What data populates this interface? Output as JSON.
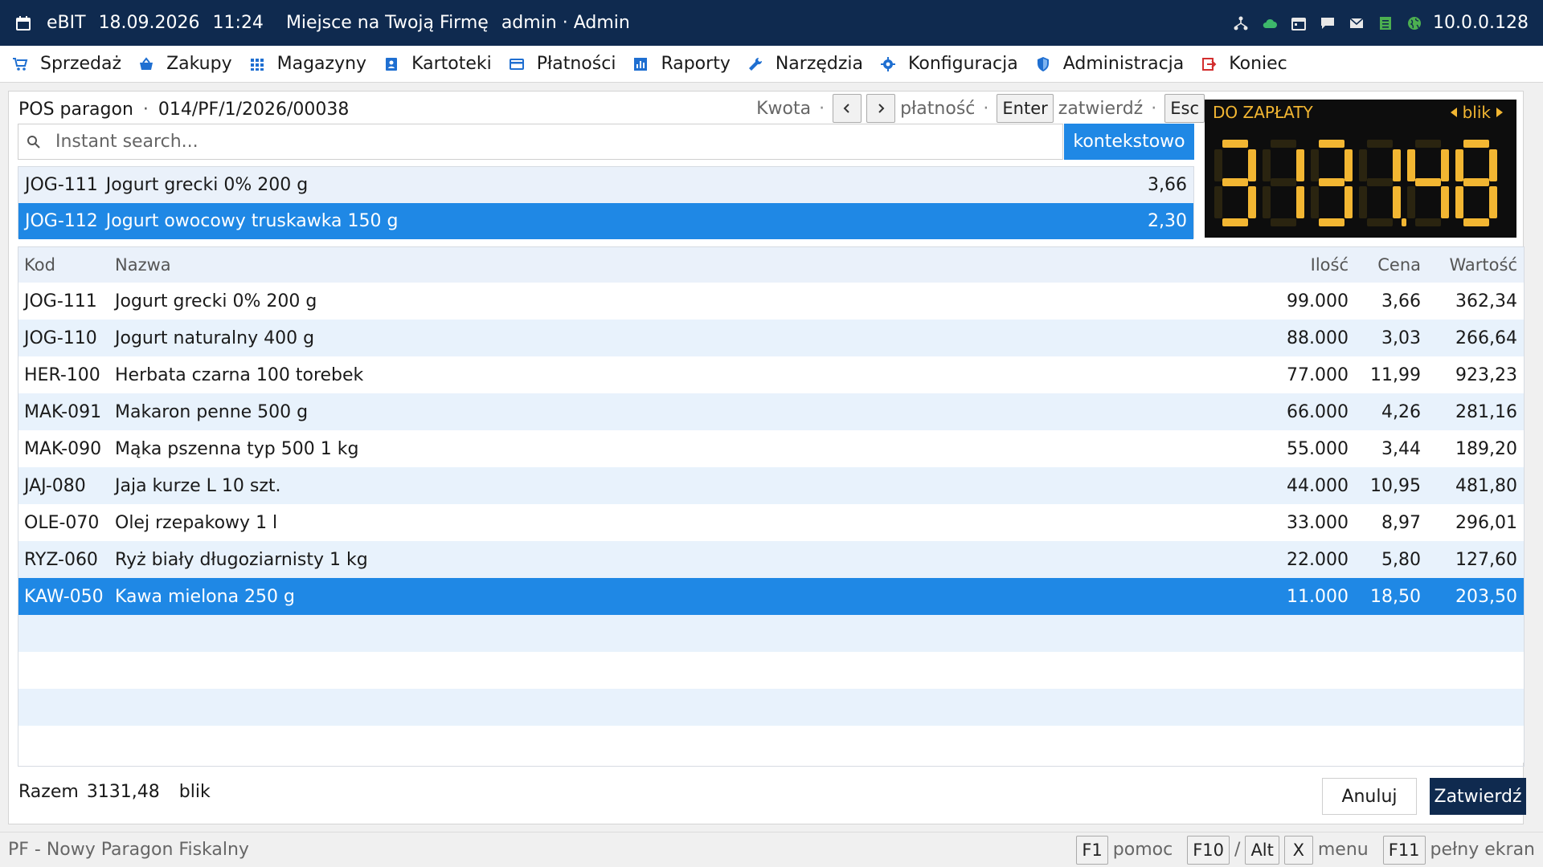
{
  "titlebar": {
    "app": "eBIT",
    "date": "18.09.2026",
    "time": "11:24",
    "company": "Miejsce na Twoją Firmę",
    "user": "admin · Admin",
    "ip": "10.0.0.128",
    "icons": [
      "calendar-icon",
      "network-icon",
      "cloud-icon",
      "calendar-icon",
      "chat-icon",
      "mail-icon",
      "list-icon",
      "globe-icon"
    ]
  },
  "menu": {
    "items": [
      {
        "label": "Sprzedaż",
        "icon": "cart-icon",
        "color": "#1f6fd1"
      },
      {
        "label": "Zakupy",
        "icon": "basket-icon",
        "color": "#1f6fd1"
      },
      {
        "label": "Magazyny",
        "icon": "grid-icon",
        "color": "#1f6fd1"
      },
      {
        "label": "Kartoteki",
        "icon": "contact-card-icon",
        "color": "#1f6fd1"
      },
      {
        "label": "Płatności",
        "icon": "credit-card-icon",
        "color": "#1f6fd1"
      },
      {
        "label": "Raporty",
        "icon": "bar-chart-icon",
        "color": "#1f6fd1"
      },
      {
        "label": "Narzędzia",
        "icon": "wrench-icon",
        "color": "#1f6fd1"
      },
      {
        "label": "Konfiguracja",
        "icon": "gear-icon",
        "color": "#1f6fd1"
      },
      {
        "label": "Administracja",
        "icon": "shield-icon",
        "color": "#1f6fd1"
      },
      {
        "label": "Koniec",
        "icon": "logout-icon",
        "color": "#d32f2f"
      }
    ]
  },
  "doc": {
    "type": "POS paragon",
    "number": "014/PF/1/2026/00038"
  },
  "shortcuts": {
    "amount_label": "Kwota",
    "payment_label": "płatność",
    "enter_key": "Enter",
    "confirm_label": "zatwierdź",
    "esc_key": "Esc"
  },
  "search": {
    "placeholder": "Instant search...",
    "value": "",
    "context_button": "kontekstowo"
  },
  "suggestions": [
    {
      "code": "JOG-111",
      "name": "Jogurt grecki 0% 200 g",
      "price": "3,66",
      "selected": false
    },
    {
      "code": "JOG-112",
      "name": "Jogurt owocowy truskawka 150 g",
      "price": "2,30",
      "selected": true
    }
  ],
  "display": {
    "label": "DO ZAPŁATY",
    "payment_method": "blik",
    "amount": "3131.48",
    "color": "#f2b632"
  },
  "table": {
    "headers": {
      "kod": "Kod",
      "nazwa": "Nazwa",
      "ilosc": "Ilość",
      "cena": "Cena",
      "wartosc": "Wartość"
    },
    "rows": [
      {
        "kod": "JOG-111",
        "nazwa": "Jogurt grecki 0% 200 g",
        "ilosc": "99.000",
        "cena": "3,66",
        "wartosc": "362,34"
      },
      {
        "kod": "JOG-110",
        "nazwa": "Jogurt naturalny 400 g",
        "ilosc": "88.000",
        "cena": "3,03",
        "wartosc": "266,64"
      },
      {
        "kod": "HER-100",
        "nazwa": "Herbata czarna 100 torebek",
        "ilosc": "77.000",
        "cena": "11,99",
        "wartosc": "923,23"
      },
      {
        "kod": "MAK-091",
        "nazwa": "Makaron penne 500 g",
        "ilosc": "66.000",
        "cena": "4,26",
        "wartosc": "281,16"
      },
      {
        "kod": "MAK-090",
        "nazwa": "Mąka pszenna typ 500 1 kg",
        "ilosc": "55.000",
        "cena": "3,44",
        "wartosc": "189,20"
      },
      {
        "kod": "JAJ-080",
        "nazwa": "Jaja kurze L 10 szt.",
        "ilosc": "44.000",
        "cena": "10,95",
        "wartosc": "481,80"
      },
      {
        "kod": "OLE-070",
        "nazwa": "Olej rzepakowy 1 l",
        "ilosc": "33.000",
        "cena": "8,97",
        "wartosc": "296,01"
      },
      {
        "kod": "RYZ-060",
        "nazwa": "Ryż biały długoziarnisty 1 kg",
        "ilosc": "22.000",
        "cena": "5,80",
        "wartosc": "127,60"
      },
      {
        "kod": "KAW-050",
        "nazwa": "Kawa mielona 250 g",
        "ilosc": "11.000",
        "cena": "18,50",
        "wartosc": "203,50",
        "selected": true
      }
    ]
  },
  "footer": {
    "total_label": "Razem",
    "total_value": "3131,48",
    "payment_method": "blik",
    "cancel": "Anuluj",
    "confirm": "Zatwierdź"
  },
  "statusbar": {
    "mode": "PF - Nowy Paragon Fiskalny",
    "f1": "F1",
    "f1_label": "pomoc",
    "f10": "F10",
    "slash": "/",
    "alt": "Alt",
    "x": "X",
    "menu_label": "menu",
    "f11": "F11",
    "f11_label": "pełny ekran"
  },
  "colors": {
    "accent": "#1f88e5",
    "titlebar": "#0f2a4f",
    "row_alt": "#e8f2fc"
  }
}
